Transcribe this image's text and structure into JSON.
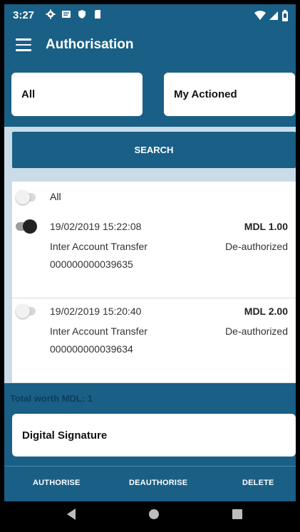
{
  "status_bar": {
    "time": "3:27",
    "icons": [
      "gear-icon",
      "message-icon",
      "shield-icon",
      "sd-card-icon"
    ],
    "right_icons": [
      "wifi-icon",
      "signal-icon",
      "battery-icon"
    ]
  },
  "app_bar": {
    "title": "Authorisation"
  },
  "filters": {
    "left_value": "All",
    "right_value": "My Actioned"
  },
  "search": {
    "label": "SEARCH"
  },
  "list": {
    "select_all_label": "All",
    "items": [
      {
        "datetime": "19/02/2019 15:22:08",
        "amount": "MDL 1.00",
        "type": "Inter Account Transfer",
        "status": "De-authorized",
        "reference": "000000000039635",
        "selected": true
      },
      {
        "datetime": "19/02/2019 15:20:40",
        "amount": "MDL 2.00",
        "type": "Inter Account Transfer",
        "status": "De-authorized",
        "reference": "000000000039634",
        "selected": false
      }
    ]
  },
  "total": {
    "text": "Total worth MDL: 1"
  },
  "signature": {
    "label": "Digital Signature"
  },
  "actions": {
    "authorise": "AUTHORISE",
    "deauthorise": "DEAUTHORISE",
    "delete": "DELETE"
  },
  "colors": {
    "primary": "#1a5f86",
    "background": "#c9dce8",
    "total_text": "#0d3e5a"
  }
}
